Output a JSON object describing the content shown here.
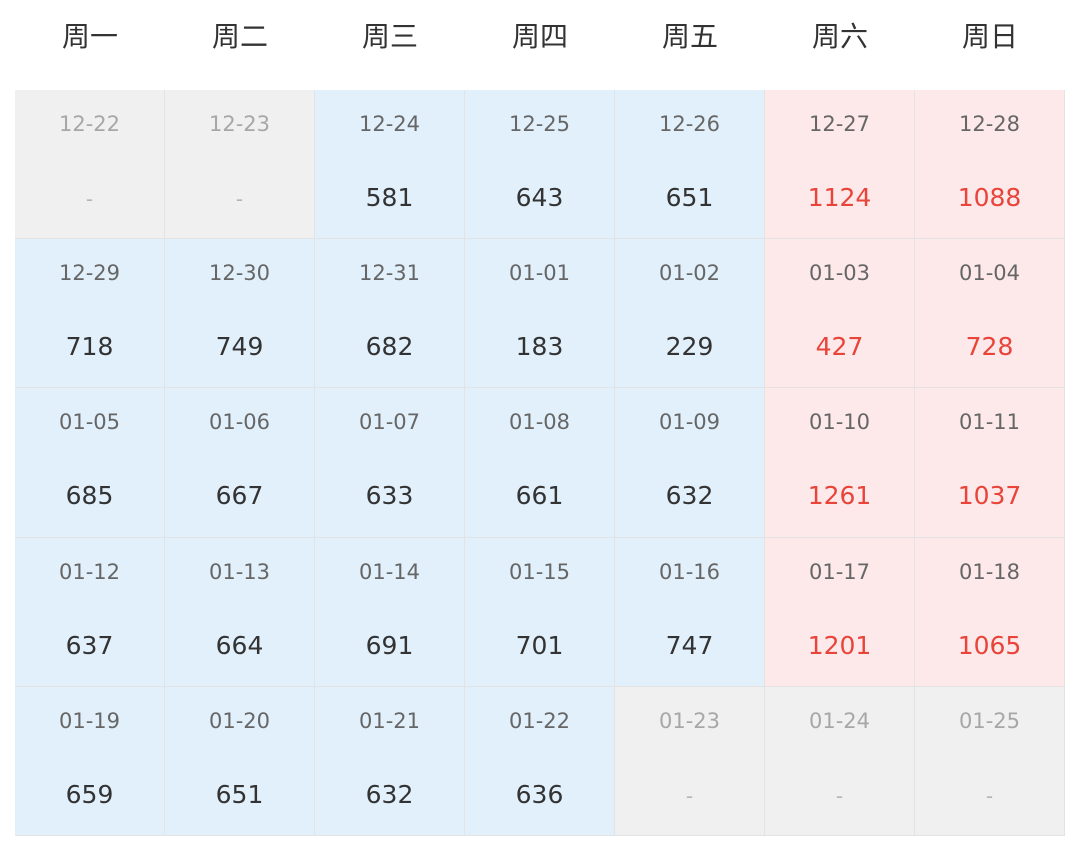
{
  "weekdays": [
    "周一",
    "周二",
    "周三",
    "周四",
    "周五",
    "周六",
    "周日"
  ],
  "colors": {
    "weekday_bg": "#e1f0fb",
    "weekend_bg": "#fde9ea",
    "inactive_bg": "#f0f0f0",
    "weekend_value": "#e8443a"
  },
  "rows": [
    [
      {
        "date": "12-22",
        "value": "-",
        "state": "inactive"
      },
      {
        "date": "12-23",
        "value": "-",
        "state": "inactive"
      },
      {
        "date": "12-24",
        "value": "581",
        "state": "weekday"
      },
      {
        "date": "12-25",
        "value": "643",
        "state": "weekday"
      },
      {
        "date": "12-26",
        "value": "651",
        "state": "weekday"
      },
      {
        "date": "12-27",
        "value": "1124",
        "state": "weekend"
      },
      {
        "date": "12-28",
        "value": "1088",
        "state": "weekend"
      }
    ],
    [
      {
        "date": "12-29",
        "value": "718",
        "state": "weekday"
      },
      {
        "date": "12-30",
        "value": "749",
        "state": "weekday"
      },
      {
        "date": "12-31",
        "value": "682",
        "state": "weekday"
      },
      {
        "date": "01-01",
        "value": "183",
        "state": "weekday"
      },
      {
        "date": "01-02",
        "value": "229",
        "state": "weekday"
      },
      {
        "date": "01-03",
        "value": "427",
        "state": "weekend"
      },
      {
        "date": "01-04",
        "value": "728",
        "state": "weekend"
      }
    ],
    [
      {
        "date": "01-05",
        "value": "685",
        "state": "weekday"
      },
      {
        "date": "01-06",
        "value": "667",
        "state": "weekday"
      },
      {
        "date": "01-07",
        "value": "633",
        "state": "weekday"
      },
      {
        "date": "01-08",
        "value": "661",
        "state": "weekday"
      },
      {
        "date": "01-09",
        "value": "632",
        "state": "weekday"
      },
      {
        "date": "01-10",
        "value": "1261",
        "state": "weekend"
      },
      {
        "date": "01-11",
        "value": "1037",
        "state": "weekend"
      }
    ],
    [
      {
        "date": "01-12",
        "value": "637",
        "state": "weekday"
      },
      {
        "date": "01-13",
        "value": "664",
        "state": "weekday"
      },
      {
        "date": "01-14",
        "value": "691",
        "state": "weekday"
      },
      {
        "date": "01-15",
        "value": "701",
        "state": "weekday"
      },
      {
        "date": "01-16",
        "value": "747",
        "state": "weekday"
      },
      {
        "date": "01-17",
        "value": "1201",
        "state": "weekend"
      },
      {
        "date": "01-18",
        "value": "1065",
        "state": "weekend"
      }
    ],
    [
      {
        "date": "01-19",
        "value": "659",
        "state": "weekday"
      },
      {
        "date": "01-20",
        "value": "651",
        "state": "weekday"
      },
      {
        "date": "01-21",
        "value": "632",
        "state": "weekday"
      },
      {
        "date": "01-22",
        "value": "636",
        "state": "weekday"
      },
      {
        "date": "01-23",
        "value": "-",
        "state": "inactive"
      },
      {
        "date": "01-24",
        "value": "-",
        "state": "inactive"
      },
      {
        "date": "01-25",
        "value": "-",
        "state": "inactive"
      }
    ]
  ]
}
